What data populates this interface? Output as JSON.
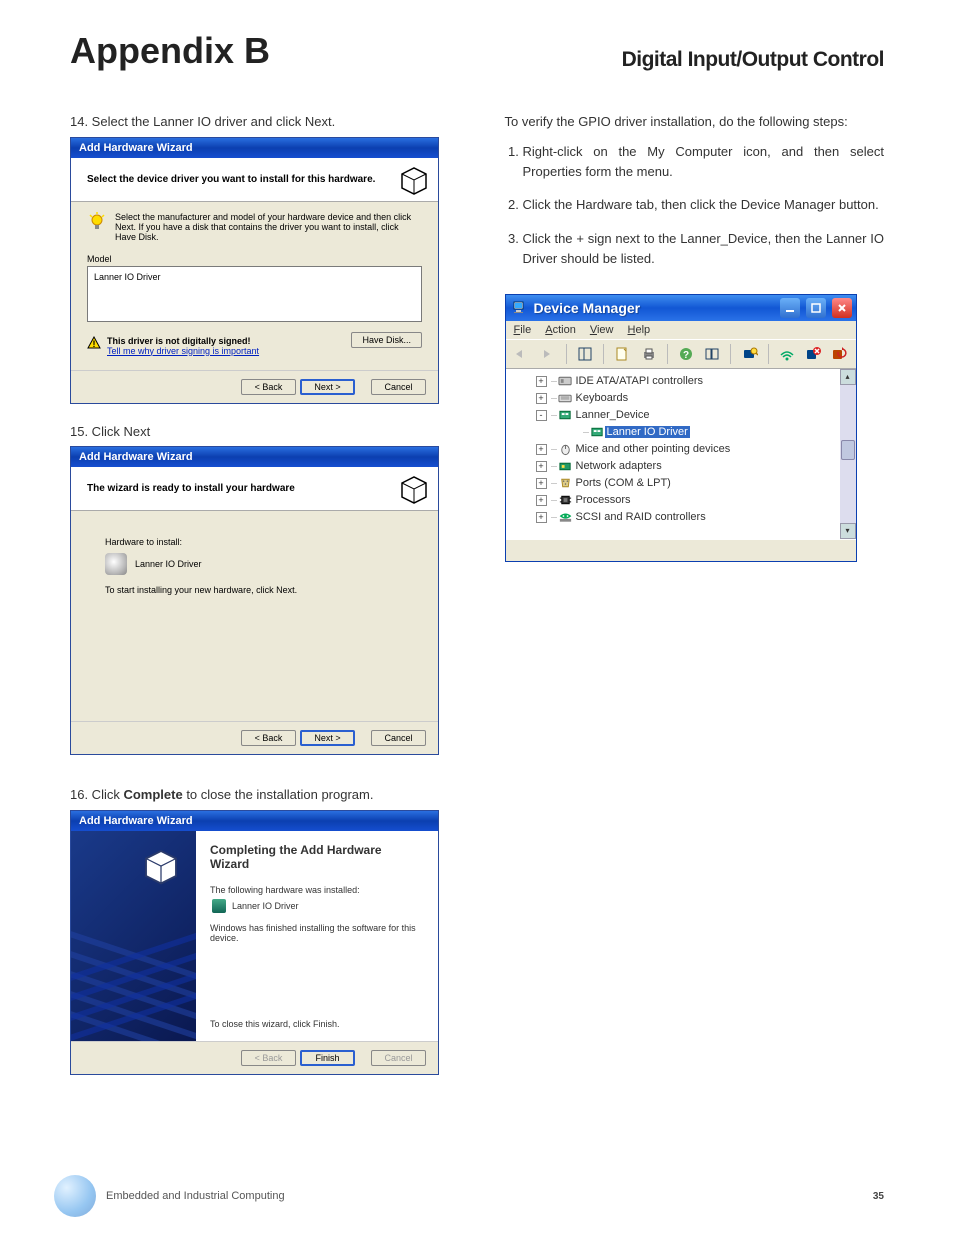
{
  "header": {
    "appendix": "Appendix B",
    "section": "Digital Input/Output Control"
  },
  "left": {
    "step14": "14. Select the Lanner IO driver and click Next.",
    "step15": "15. Click Next",
    "step16_pre": "16. Click ",
    "step16_bold": "Complete",
    "step16_post": " to close the installation program."
  },
  "wiz1": {
    "title": "Add Hardware Wizard",
    "header": "Select the device driver you want to install for this hardware.",
    "info": "Select the manufacturer and model of your hardware device and then click Next. If you have a disk that contains the driver you want to install, click Have Disk.",
    "model_label": "Model",
    "model_item": "Lanner IO Driver",
    "warn_bold": "This driver is not digitally signed!",
    "warn_link": "Tell me why driver signing is important",
    "have_disk": "Have Disk...",
    "back": "< Back",
    "next": "Next >",
    "cancel": "Cancel"
  },
  "wiz2": {
    "title": "Add Hardware Wizard",
    "header": "The wizard is ready to install your hardware",
    "label": "Hardware to install:",
    "item": "Lanner IO Driver",
    "note": "To start installing your new hardware, click Next.",
    "back": "< Back",
    "next": "Next >",
    "cancel": "Cancel"
  },
  "wiz3": {
    "title": "Add Hardware Wizard",
    "heading": "Completing the Add Hardware Wizard",
    "sub1": "The following hardware was installed:",
    "item": "Lanner IO Driver",
    "sub2": "Windows has finished installing the software for this device.",
    "close_text": "To close this wizard, click Finish.",
    "back": "< Back",
    "finish": "Finish",
    "cancel": "Cancel"
  },
  "right": {
    "intro": "To verify the GPIO driver installation, do the following steps:",
    "steps": [
      "Right-click on the My Computer icon, and then select Properties form the menu.",
      "Click the Hardware tab, then click the Device Manager button.",
      "Click the + sign next to the Lanner_Device, then the Lanner IO Driver should be listed."
    ]
  },
  "devmgr": {
    "title": "Device Manager",
    "menu": {
      "file": "File",
      "action": "Action",
      "view": "View",
      "help": "Help"
    },
    "tree": [
      {
        "lvl": 1,
        "toggle": "+",
        "icon": "ide",
        "label": "IDE ATA/ATAPI controllers"
      },
      {
        "lvl": 1,
        "toggle": "+",
        "icon": "kbd",
        "label": "Keyboards"
      },
      {
        "lvl": 1,
        "toggle": "-",
        "icon": "dev",
        "label": "Lanner_Device"
      },
      {
        "lvl": 2,
        "toggle": "",
        "icon": "drv",
        "label": "Lanner IO Driver",
        "selected": true
      },
      {
        "lvl": 1,
        "toggle": "+",
        "icon": "mouse",
        "label": "Mice and other pointing devices"
      },
      {
        "lvl": 1,
        "toggle": "+",
        "icon": "net",
        "label": "Network adapters"
      },
      {
        "lvl": 1,
        "toggle": "+",
        "icon": "port",
        "label": "Ports (COM & LPT)"
      },
      {
        "lvl": 1,
        "toggle": "+",
        "icon": "cpu",
        "label": "Processors"
      },
      {
        "lvl": 1,
        "toggle": "+",
        "icon": "scsi",
        "label": "SCSI and RAID controllers"
      }
    ]
  },
  "footer": {
    "text": "Embedded and Industrial Computing",
    "page": "35"
  }
}
